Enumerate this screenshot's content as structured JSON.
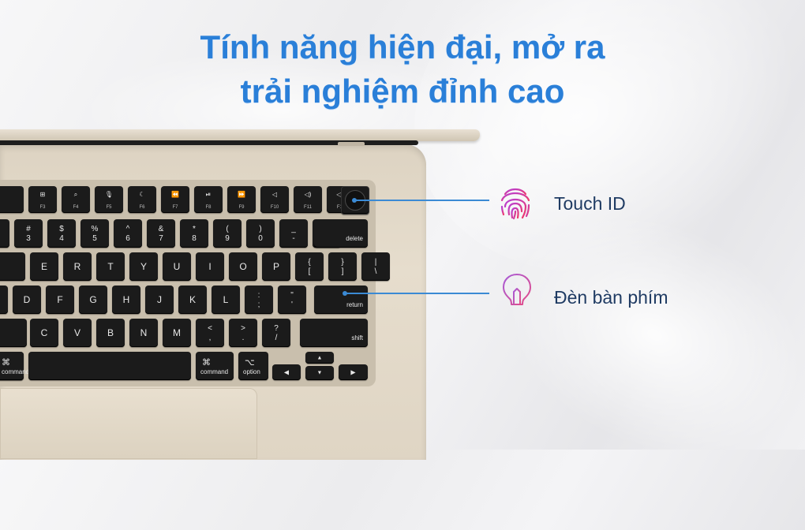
{
  "headline": {
    "line1": "Tính năng hiện đại, mở ra",
    "line2": "trải nghiệm đỉnh cao"
  },
  "callouts": [
    {
      "label": "Touch ID",
      "icon": "fingerprint-icon",
      "color": "#d9399b"
    },
    {
      "label": "Đèn bàn phím",
      "icon": "lightbulb-icon",
      "color": "#c44fcf"
    }
  ],
  "keyboard": {
    "function_row": [
      {
        "icon": "⊞",
        "fn": "F3"
      },
      {
        "icon": "⌕",
        "fn": "F4"
      },
      {
        "icon": "🎙",
        "fn": "F5"
      },
      {
        "icon": "☾",
        "fn": "F6"
      },
      {
        "icon": "⏪",
        "fn": "F7"
      },
      {
        "icon": "⏯",
        "fn": "F8"
      },
      {
        "icon": "⏩",
        "fn": "F9"
      },
      {
        "icon": "◁",
        "fn": "F10"
      },
      {
        "icon": "◁)",
        "fn": "F11"
      },
      {
        "icon": "◁))",
        "fn": "F12"
      }
    ],
    "number_row": [
      {
        "top": "#",
        "bot": "3"
      },
      {
        "top": "$",
        "bot": "4"
      },
      {
        "top": "%",
        "bot": "5"
      },
      {
        "top": "^",
        "bot": "6"
      },
      {
        "top": "&",
        "bot": "7"
      },
      {
        "top": "*",
        "bot": "8"
      },
      {
        "top": "(",
        "bot": "9"
      },
      {
        "top": ")",
        "bot": "0"
      },
      {
        "top": "_",
        "bot": "-"
      },
      {
        "top": "+",
        "bot": "="
      }
    ],
    "delete_label": "delete",
    "qwerty_row": [
      "E",
      "R",
      "T",
      "Y",
      "U",
      "I",
      "O",
      "P"
    ],
    "qwerty_brackets": [
      {
        "top": "{",
        "bot": "["
      },
      {
        "top": "}",
        "bot": "]"
      },
      {
        "top": "|",
        "bot": "\\"
      }
    ],
    "home_row": [
      "D",
      "F",
      "G",
      "H",
      "J",
      "K",
      "L"
    ],
    "home_punct": [
      {
        "top": ":",
        "bot": ";"
      },
      {
        "top": "\"",
        "bot": "'"
      }
    ],
    "return_label": "return",
    "bottom_row": [
      "C",
      "V",
      "B",
      "N",
      "M"
    ],
    "bottom_punct": [
      {
        "top": "<",
        "bot": ","
      },
      {
        "top": ">",
        "bot": "."
      },
      {
        "top": "?",
        "bot": "/"
      }
    ],
    "shift_label": "shift",
    "space_row": {
      "cmd_left_label": "command",
      "cmd_left_symbol": "⌘",
      "cmd_right_label": "command",
      "cmd_right_symbol": "⌘",
      "option_label": "option",
      "option_symbol": "⌥"
    },
    "arrows": {
      "left": "◀",
      "up": "▲",
      "down": "▼",
      "right": "▶"
    }
  }
}
